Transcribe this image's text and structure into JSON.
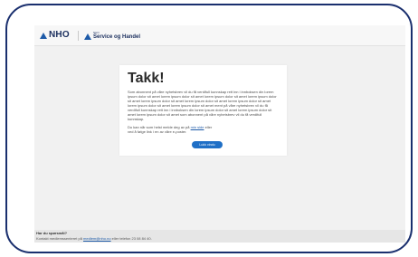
{
  "header": {
    "logo_nho": "NHO",
    "logo_sh_small": "NHO",
    "logo_sh_text": "Service og Handel"
  },
  "main": {
    "title": "Takk!",
    "paragraph1": "Som abonnent på våre nyhetsbrev vil du få verdifull kunnskap rett inn i innboksen din lorem ipsum dolor sit amet lorem ipsum dolor sit amet lorem ipsum dolor sit amet lorem ipsum dolor sit amet lorem ipsum dolor sit amet lorem ipsum dolor sit amet lorem ipsum dolor sit amet lorem ipsum dolor sit amet lorem ipsum dolor sit amet ment på våre nyhetsbrev vil du få verdifull kunnskap rett inn i innboksen din lorem ipsum dolor sit amet lorem ipsum dolor sit amet lorem ipsum dolor sit amet som abonnent på våre nyhetsbrev vil du få verdifull kunnskap.",
    "paragraph2_before": "Du kan når som helst melde deg av på ",
    "paragraph2_link": "min side",
    "paragraph2_after": " eller",
    "paragraph2_line2": "ved å følge link i en av våre e-poster.",
    "button_label": "Lukk vindu"
  },
  "footer": {
    "question": "Har du spørsmål?",
    "contact_before": "Kontakt medlemssenteret på ",
    "contact_email": "medlem@nho.no",
    "contact_after": " eller telefon 23 08 84 40."
  }
}
